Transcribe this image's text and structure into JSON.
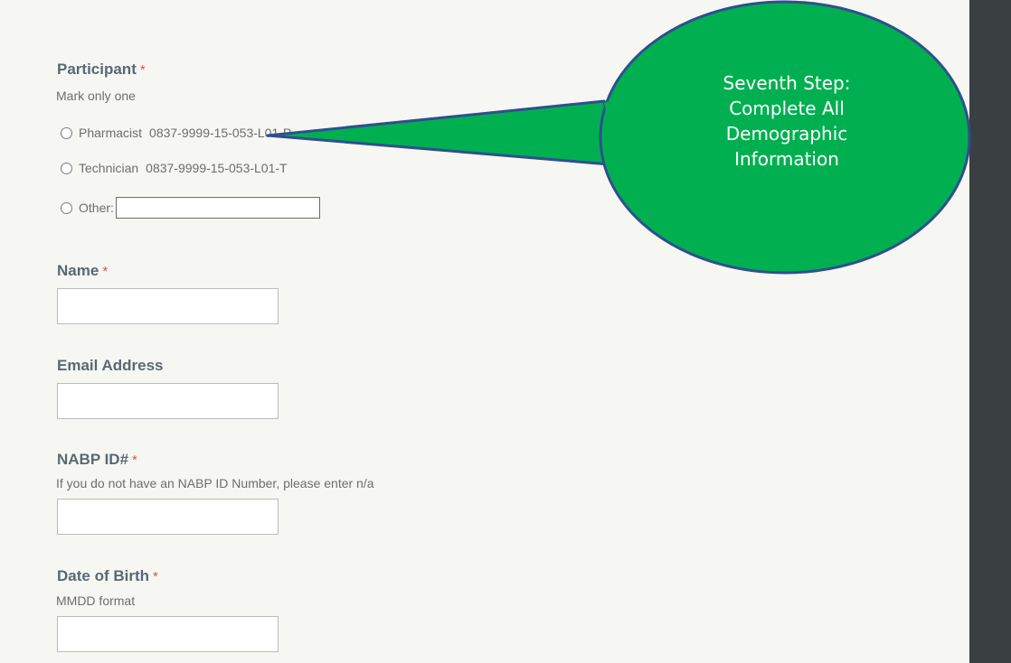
{
  "participant": {
    "label": "Participant",
    "required_mark": "*",
    "helper": "Mark only one",
    "options": [
      {
        "label": "Pharmacist",
        "code": "0837-9999-15-053-L01-P"
      },
      {
        "label": "Technician",
        "code": "0837-9999-15-053-L01-T"
      }
    ],
    "other_label": "Other:",
    "other_value": ""
  },
  "name": {
    "label": "Name",
    "required_mark": "*",
    "value": ""
  },
  "email": {
    "label": "Email Address",
    "value": ""
  },
  "nabp": {
    "label": "NABP ID#",
    "required_mark": "*",
    "helper": "If you do not have an NABP ID Number, please enter n/a",
    "value": ""
  },
  "dob": {
    "label": "Date of Birth",
    "required_mark": "*",
    "helper": "MMDD format",
    "value": ""
  },
  "callout": {
    "lines": [
      "Seventh Step:",
      "Complete All",
      "Demographic",
      "Information"
    ],
    "fill_color": "#00b050",
    "border_color": "#2f4f8f"
  }
}
